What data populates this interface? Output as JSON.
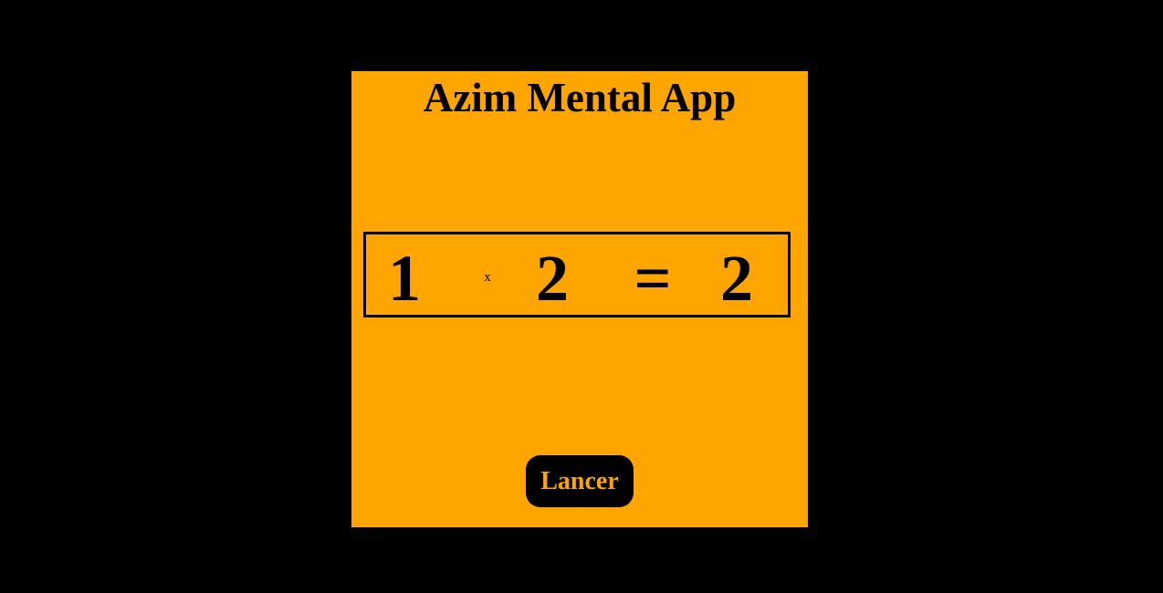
{
  "app": {
    "title": "Azim Mental App"
  },
  "equation": {
    "operand_a": "1",
    "operator": "x",
    "operand_b": "2",
    "equals": "=",
    "result": "2"
  },
  "controls": {
    "launch_label": "Lancer"
  },
  "colors": {
    "background": "#000000",
    "panel": "#FFA500",
    "text": "#000000",
    "button_bg": "#000000",
    "button_text": "#FFA500"
  }
}
